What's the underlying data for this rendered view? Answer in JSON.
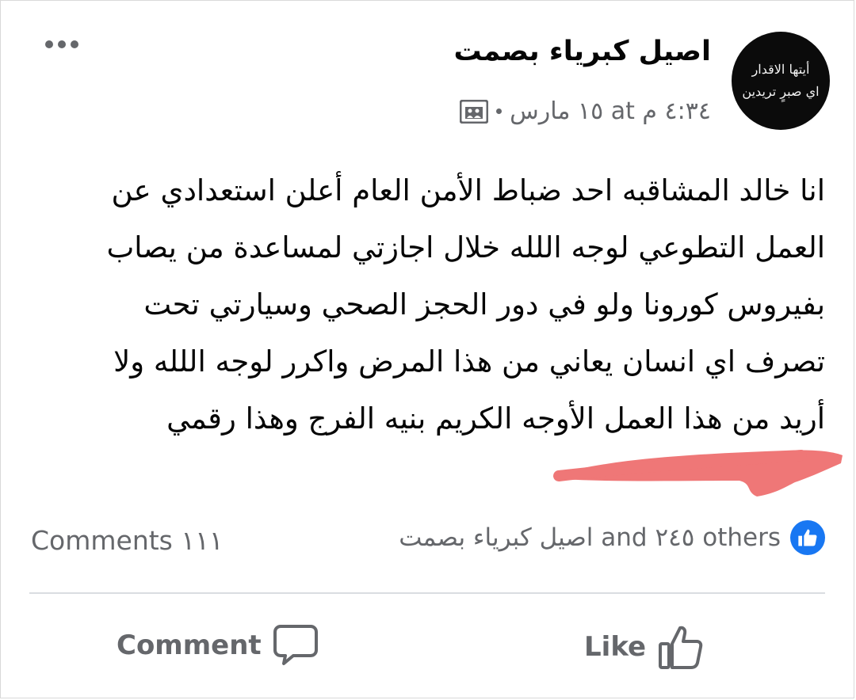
{
  "post": {
    "author": "اصيل كبرياء بصمت",
    "avatar_text": [
      "أيتها الاقدار",
      "اي صبرٍ تريدين"
    ],
    "timestamp": "١٥ مارس at ٤:٣٤ م",
    "privacy_icon": "album-icon",
    "more_icon": "more-icon",
    "body": "انا خالد المشاقبه احد ضباط الأمن العام أعلن استعدادي عن\nالعمل التطوعي لوجه اللله خلال اجازتي لمساعدة من يصاب\nبفيروس كورونا ولو في دور الحجز الصحي وسيارتي تحت\nتصرف اي انسان يعاني من هذا المرض واكرر لوجه اللله ولا\nأريد  من هذا العمل الأوجه الكريم بنيه الفرج وهذا رقمي"
  },
  "reactions": {
    "icon": "like-reaction-icon",
    "text": "اصيل كبرياء بصمت and ٢٤٥ others",
    "comments": "Comments ١١١"
  },
  "actions": {
    "like": "Like",
    "comment": "Comment"
  },
  "colors": {
    "brand": "#1877f2",
    "secondary_text": "#65676b",
    "redaction": "#ef7777"
  }
}
